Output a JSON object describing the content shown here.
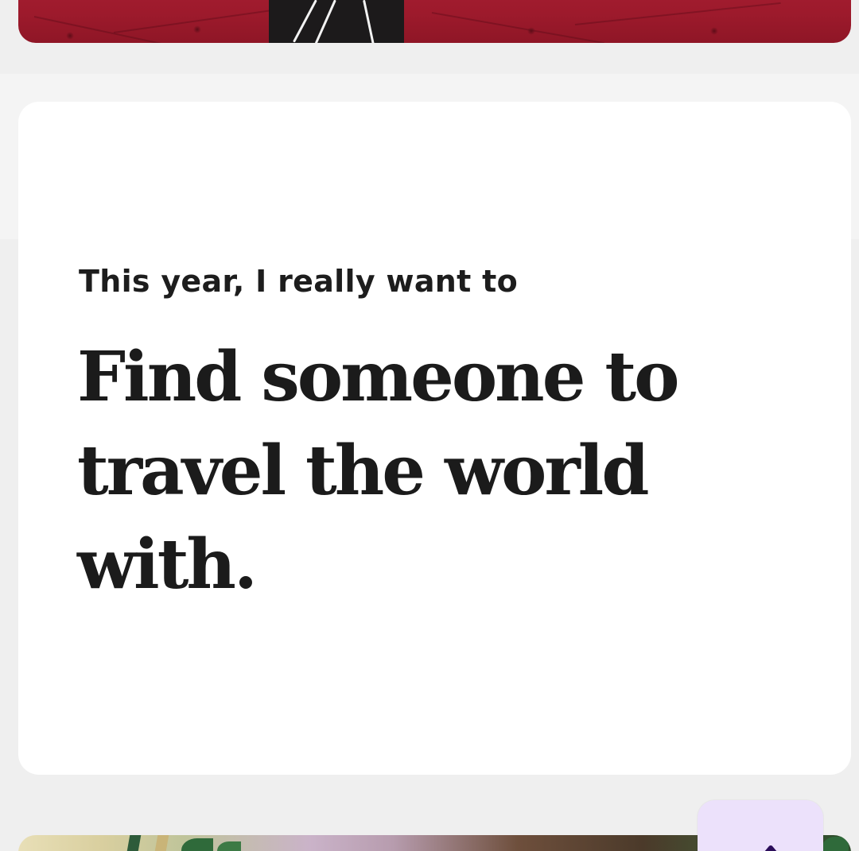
{
  "prompt": {
    "label": "This year, I really want to",
    "answer": "Find someone to travel the world with."
  },
  "fab": {
    "icon": "chevron-up-icon",
    "background_color": "#ece1fb",
    "icon_color": "#2b0d59"
  },
  "colors": {
    "page_background": "#efefef",
    "card_background": "#ffffff",
    "text": "#1b1b1b"
  }
}
